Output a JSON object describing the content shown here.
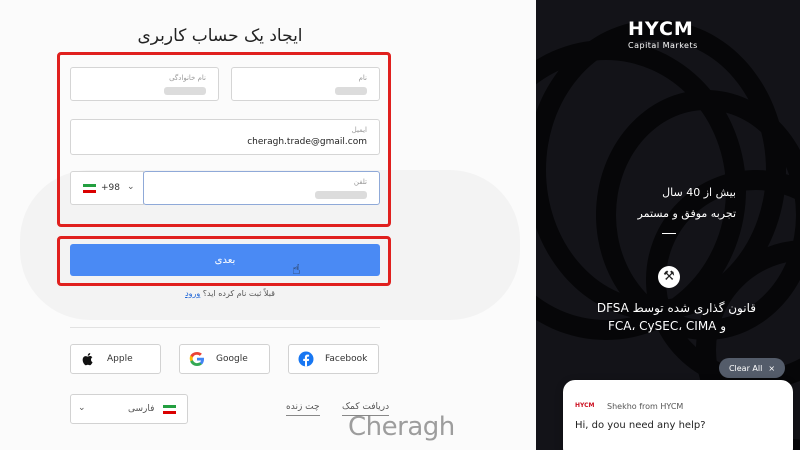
{
  "form": {
    "title": "ایجاد یک حساب کاربری",
    "first_name_label": "نام",
    "last_name_label": "نام خانوادگی",
    "email_label": "ایمیل",
    "email_value": "cheragh.trade@gmail.com",
    "phone_label": "تلفن",
    "country_code": "+98",
    "next_button": "بعدی",
    "already_registered": "قبلاً ثبت نام کرده اید؟",
    "login_link": "ورود"
  },
  "social": {
    "apple": "Apple",
    "google": "Google",
    "facebook": "Facebook"
  },
  "footer": {
    "language": "فارسی",
    "live_chat": "چت زنده",
    "get_help": "دریافت کمک"
  },
  "watermark": "Cheragh",
  "brand": {
    "logo": "HYCM",
    "logo_sub": "Capital Markets",
    "tagline_1": "بیش از 40 سال",
    "tagline_2": "تجربه موفق و مستمر",
    "regulation_1": "قانون گذاری شده توسط DFSA",
    "regulation_2": "FCA، CySEC، CIMA و"
  },
  "chat": {
    "clear_all": "Clear All",
    "close_icon": "×",
    "avatar": "HYCM",
    "sender": "Shekho from HYCM",
    "message": "Hi, do you need any help?"
  },
  "colors": {
    "primary_button": "#4a8af4",
    "highlight_red": "#e0201e",
    "link_blue": "#1a62d6",
    "dark_panel": "#141519"
  },
  "icons": [
    "apple-icon",
    "google-icon",
    "facebook-icon",
    "iran-flag-icon",
    "chevron-down-icon",
    "gavel-icon",
    "pointer-cursor-icon",
    "close-icon"
  ]
}
